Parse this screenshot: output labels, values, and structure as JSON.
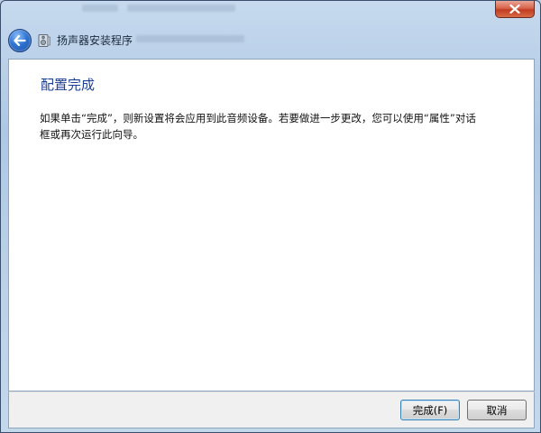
{
  "window": {
    "title": "扬声器安装程序"
  },
  "icons": {
    "back": "back-arrow-icon",
    "app": "speaker-setup-icon",
    "close": "close-icon"
  },
  "content": {
    "heading": "配置完成",
    "body": "如果单击“完成”，则新设置将会应用到此音频设备。若要做进一步更改，您可以使用“属性”对话框或再次运行此向导。"
  },
  "footer": {
    "finish_label": "完成(F)",
    "cancel_label": "取消"
  },
  "colors": {
    "heading": "#1c3f94",
    "close_button": "#c23c22",
    "back_button": "#2f74d1"
  }
}
